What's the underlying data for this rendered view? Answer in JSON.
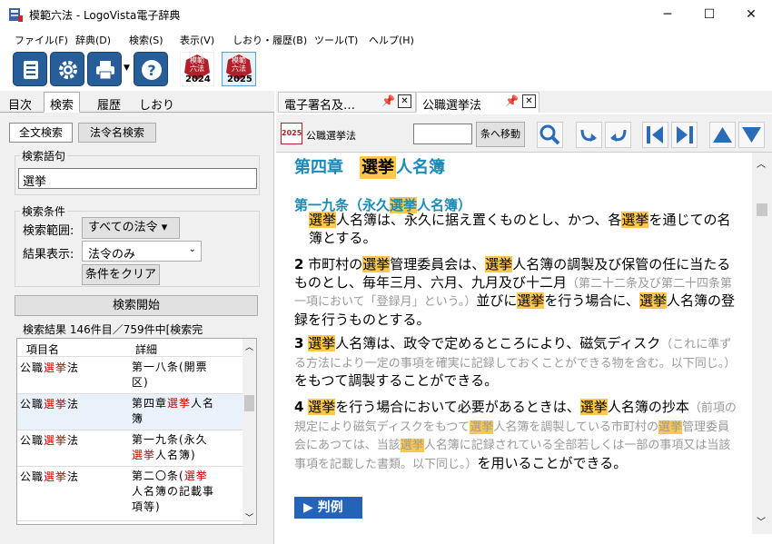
{
  "window": {
    "title": "模範六法 - LogoVista電子辞典",
    "minimize": "─",
    "maximize": "☐",
    "close": "✕"
  },
  "menu": [
    "ファイル(F)",
    "辞典(D)",
    "検索(S)",
    "表示(V)",
    "しおり・履歴(B)",
    "ツール(T)",
    "ヘルプ(H)"
  ],
  "toolbar": {
    "books": [
      {
        "line1": "模範",
        "line2": "六法",
        "year": "2024"
      },
      {
        "line1": "模範",
        "line2": "六法",
        "year": "2025"
      }
    ]
  },
  "left_tabs": [
    "目次",
    "検索",
    "履歴",
    "しおり"
  ],
  "search": {
    "mode_tabs": [
      "全文検索",
      "法令名検索"
    ],
    "term_label": "検索語句",
    "term_value": "選挙",
    "cond_label": "検索条件",
    "range_label": "検索範囲:",
    "range_value": "すべての法令 ▾",
    "display_label": "結果表示:",
    "display_value": "法令のみ",
    "clear_button": "条件をクリア",
    "start_button": "検索開始",
    "results_label": "検索結果 146件目／759件中[検索完",
    "col_item": "項目名",
    "col_detail": "詳細",
    "rows": [
      {
        "item_a": "公職",
        "item_b": "選挙",
        "item_c": "法",
        "d1": "第一八条(開票",
        "d2": "区)",
        "d3": ""
      },
      {
        "item_a": "公職",
        "item_b": "選挙",
        "item_c": "法",
        "d1": "第四章",
        "d1r": "選挙",
        "d1c": "人名",
        "d2": "簿",
        "d3": ""
      },
      {
        "item_a": "公職",
        "item_b": "選挙",
        "item_c": "法",
        "d1": "第一九条(永久",
        "d2r": "選挙",
        "d2c": "人名簿)",
        "d3": ""
      },
      {
        "item_a": "公職",
        "item_b": "選挙",
        "item_c": "法",
        "d1": "第二〇条(",
        "d1r": "選挙",
        "d2": "人名簿の記載事",
        "d3": "項等)"
      }
    ]
  },
  "right_tabs": [
    "電子署名及…",
    "公職選挙法"
  ],
  "nav": {
    "book_year": "2025",
    "law_name": "公職選挙法",
    "jump_input": "",
    "jump_button": "条へ移動"
  },
  "article": {
    "chapter_a": "第四章　",
    "chapter_b": "選挙",
    "chapter_c": "人名簿",
    "heading_a": "第一九条（永久",
    "heading_b": "選挙",
    "heading_c": "人名簿）",
    "p1": [
      [
        "選挙",
        "h"
      ],
      [
        "人名簿は、永久に据え置くものとし、かつ、各",
        ""
      ],
      [
        "選挙",
        "h"
      ],
      [
        "を通じての名簿とする。",
        ""
      ]
    ],
    "p2_num": "2",
    "p2": [
      [
        " 市町村の",
        ""
      ],
      [
        "選挙",
        "h"
      ],
      [
        "管理委員会は、",
        ""
      ],
      [
        "選挙",
        "h"
      ],
      [
        "人名簿の調製及び保管の任に当たるものとし、毎年三月、六月、九月及び十二月",
        ""
      ],
      [
        "（第二十二条及び第二十四条第一項において「登録月」という。）",
        "g"
      ],
      [
        "並びに",
        ""
      ],
      [
        "選挙",
        "h"
      ],
      [
        "を行う場合に、",
        ""
      ],
      [
        "選挙",
        "h"
      ],
      [
        "人名簿の登録を行うものとする。",
        ""
      ]
    ],
    "p3_num": "3",
    "p3": [
      [
        " ",
        ""
      ],
      [
        "選挙",
        "h"
      ],
      [
        "人名簿は、政令で定めるところにより、磁気ディスク",
        ""
      ],
      [
        "（これに準ずる方法により一定の事項を確実に記録しておくことができる物を含む。以下同じ。）",
        "g"
      ],
      [
        "をもつて調製することができる。",
        ""
      ]
    ],
    "p4_num": "4",
    "p4": [
      [
        " ",
        ""
      ],
      [
        "選挙",
        "h"
      ],
      [
        "を行う場合において必要があるときは、",
        ""
      ],
      [
        "選挙",
        "h"
      ],
      [
        "人名簿の抄本",
        ""
      ],
      [
        "（前項の規定により磁気ディスクをもつて",
        "g"
      ],
      [
        "選挙",
        "hg"
      ],
      [
        "人名簿を調製している市町村の",
        "g"
      ],
      [
        "選挙",
        "hg"
      ],
      [
        "管理委員会にあつては、当該",
        "g"
      ],
      [
        "選挙",
        "hg"
      ],
      [
        "人名簿に記録されている全部若しくは一部の事項又は当該事項を記載した書類。以下同じ。）",
        "g"
      ],
      [
        "を用いることができる。",
        ""
      ]
    ],
    "precedent_button": "▶ 判例"
  },
  "colors": {
    "accent": "#275e9a",
    "heading": "#1a8bb8",
    "highlight": "#ffc84a",
    "red": "#d00000"
  }
}
